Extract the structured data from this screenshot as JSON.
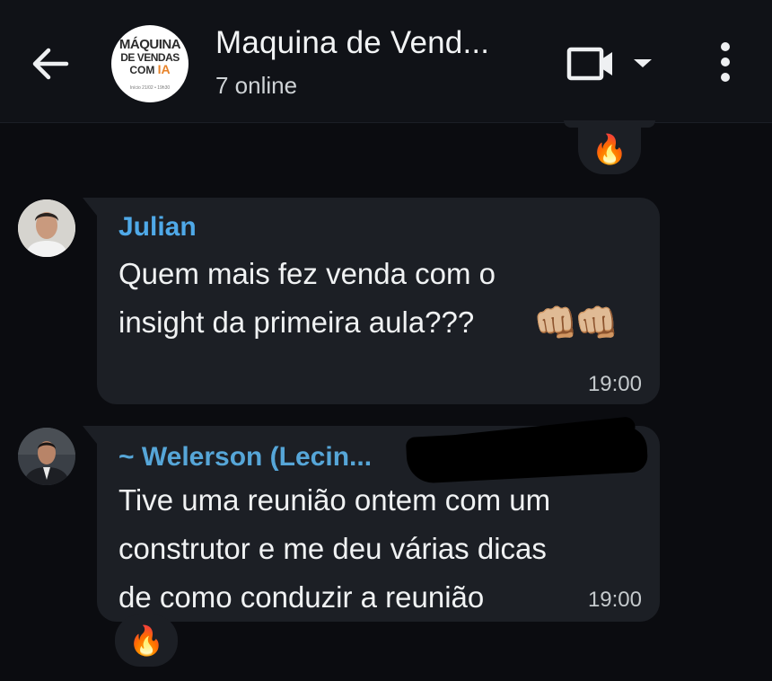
{
  "header": {
    "title": "Maquina de Vend...",
    "status": "7 online",
    "logo": {
      "line1": "MÁQUINA",
      "line2": "DE VENDAS",
      "line3_prefix": "COM ",
      "line3_accent": "IA",
      "line4": "Início 21/02 • 19h30"
    },
    "icons": [
      "back-arrow-icon",
      "video-camera-icon",
      "chevron-down-icon",
      "more-vertical-icon"
    ]
  },
  "messages": [
    {
      "sender": "Julian",
      "text": "Quem mais fez venda com o\ninsight da primeira aula???",
      "emojis": "👊🏼👊🏼",
      "time": "19:00"
    },
    {
      "sender": "~ Welerson (Lecin...",
      "text": "Tive uma reunião ontem com um\nconstrutor e me deu várias dicas\nde como conduzir a reunião",
      "time": "19:00",
      "reaction": "🔥"
    }
  ],
  "top_reaction": "🔥",
  "colors": {
    "background": "#0b0c10",
    "header": "#101217",
    "bubble": "#1c1f25",
    "sender_julian": "#4fa9e8",
    "sender_welerson": "#56a6d8",
    "logo_accent": "#e7832a"
  }
}
